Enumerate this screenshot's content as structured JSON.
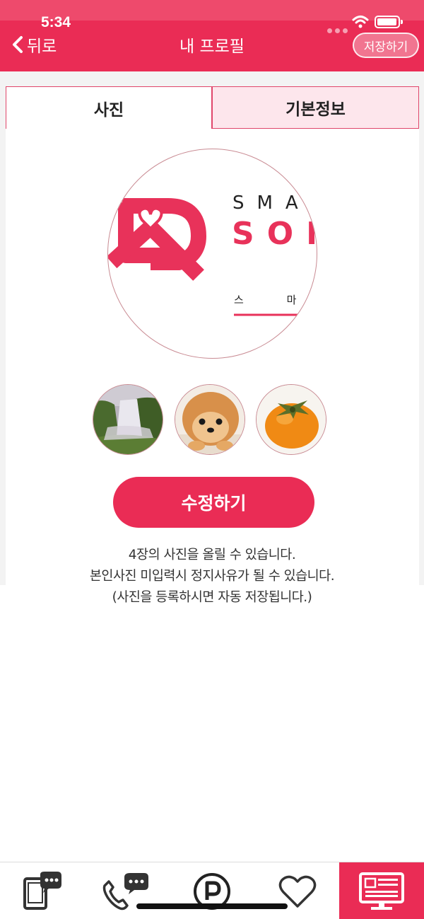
{
  "status_bar": {
    "time": "5:34"
  },
  "header": {
    "back_label": "뒤로",
    "title": "내 프로필",
    "save_label": "저장하기"
  },
  "tabs": [
    {
      "label": "사진",
      "active": true
    },
    {
      "label": "기본정보",
      "active": false
    }
  ],
  "main_photo": {
    "logo_top": "SMA",
    "logo_main": "SOM",
    "logo_sub": "스 마"
  },
  "thumbnails": [
    {
      "subject": "waterfall"
    },
    {
      "subject": "puppy"
    },
    {
      "subject": "persimmon"
    }
  ],
  "edit_button": {
    "label": "수정하기"
  },
  "info": {
    "line1": "4장의 사진을 올릴 수 있습니다.",
    "line2": "본인사진 미입력시 정지사유가 될 수 있습니다.",
    "line3": "(사진을 등록하시면 자동 저장됩니다.)"
  },
  "bottom_nav": [
    {
      "icon": "phone-chat-icon"
    },
    {
      "icon": "call-chat-icon"
    },
    {
      "icon": "points-icon"
    },
    {
      "icon": "heart-icon"
    },
    {
      "icon": "profile-board-icon",
      "active": true
    }
  ],
  "colors": {
    "accent": "#ea2c55",
    "tab_inactive": "#fde6ec",
    "border": "#e0466a"
  }
}
